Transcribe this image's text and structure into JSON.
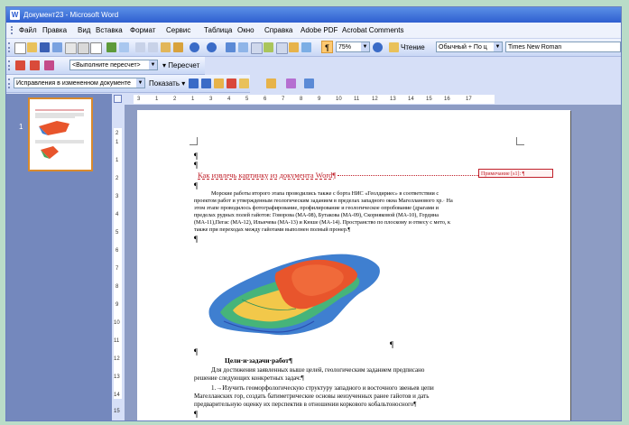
{
  "window": {
    "title": "Документ23 - Microsoft Word",
    "app_icon": "W"
  },
  "menu": [
    "Файл",
    "Правка",
    "Вид",
    "Вставка",
    "Формат",
    "Сервис",
    "Таблица",
    "Окно",
    "Справка",
    "Adobe PDF",
    "Acrobat Comments"
  ],
  "toolbar_standard": {
    "zoom": "75%",
    "read_label": "Чтение",
    "style": "Обычный + По ц",
    "font": "Times New Roman"
  },
  "toolbar_fields": {
    "field_combo": "<Выполните пересчет>",
    "recalc_label": "Пересчет"
  },
  "toolbar_review": {
    "display_combo": "Исправления в измененном документе",
    "show_label": "Показать"
  },
  "thumbnails": {
    "page_number": "1"
  },
  "ruler": {
    "h_labels": [
      "3",
      "1",
      "2",
      "1",
      "1",
      "1",
      "2",
      "1",
      "3",
      "1",
      "4",
      "1",
      "5",
      "1",
      "6",
      "1",
      "7",
      "1",
      "8",
      "1",
      "9",
      "1",
      "10",
      "1",
      "11",
      "1",
      "12",
      "1",
      "13",
      "1",
      "14",
      "1",
      "15",
      "1",
      "16",
      "1",
      "17"
    ],
    "v_labels": [
      "2",
      "1",
      "1",
      "1",
      "1",
      "2",
      "1",
      "3",
      "1",
      "4",
      "1",
      "5",
      "1",
      "6",
      "1",
      "7",
      "1",
      "8",
      "1",
      "9",
      "1",
      "10",
      "1",
      "11",
      "1",
      "12",
      "1",
      "13",
      "1",
      "14",
      "1",
      "15"
    ]
  },
  "document": {
    "heading": "Как извлечь картинку из документа Word¶",
    "comment": "Примечание [s1]: ¶",
    "paragraph1": [
      "Морские работы второго этапа проводились также с борта НИС «Геолдириес» в соответствии с",
      "проектом работ и утвержденным геологическим заданием в пределах западного окна Магелланового хр.· На",
      "этом этапе проводилось фотографирование, профилирование и геологическое опробование (драгами и",
      "пределах рудных полей гайотов: Говорова (МА-08), Бутакова (МА-09), Скорняковой (МА-10), Гордина",
      "(МА-11),Пегас (МА-12), Ильичева (МА-13) и Кюше (МА-14). Пространство по плоскому и отвесу с мето, к",
      "также при переходах между гайотами выполнен полный пронер.¶"
    ],
    "section_title": "Цели·и·задачи·работ¶",
    "paragraph2": [
      "Для достижения заявленных выше целей, геологическим заданием предписано",
      "решение следующих конкретных задач:¶",
      "1.→Изучить геоморфологическую структуру западного и восточного звеньев цепи",
      "Магелланских гор, создать батиметрические основы неизученных ранее гайотов и дать",
      "предварительную оценку их перспектив в отношении коркового кобальтоносного¶"
    ]
  }
}
